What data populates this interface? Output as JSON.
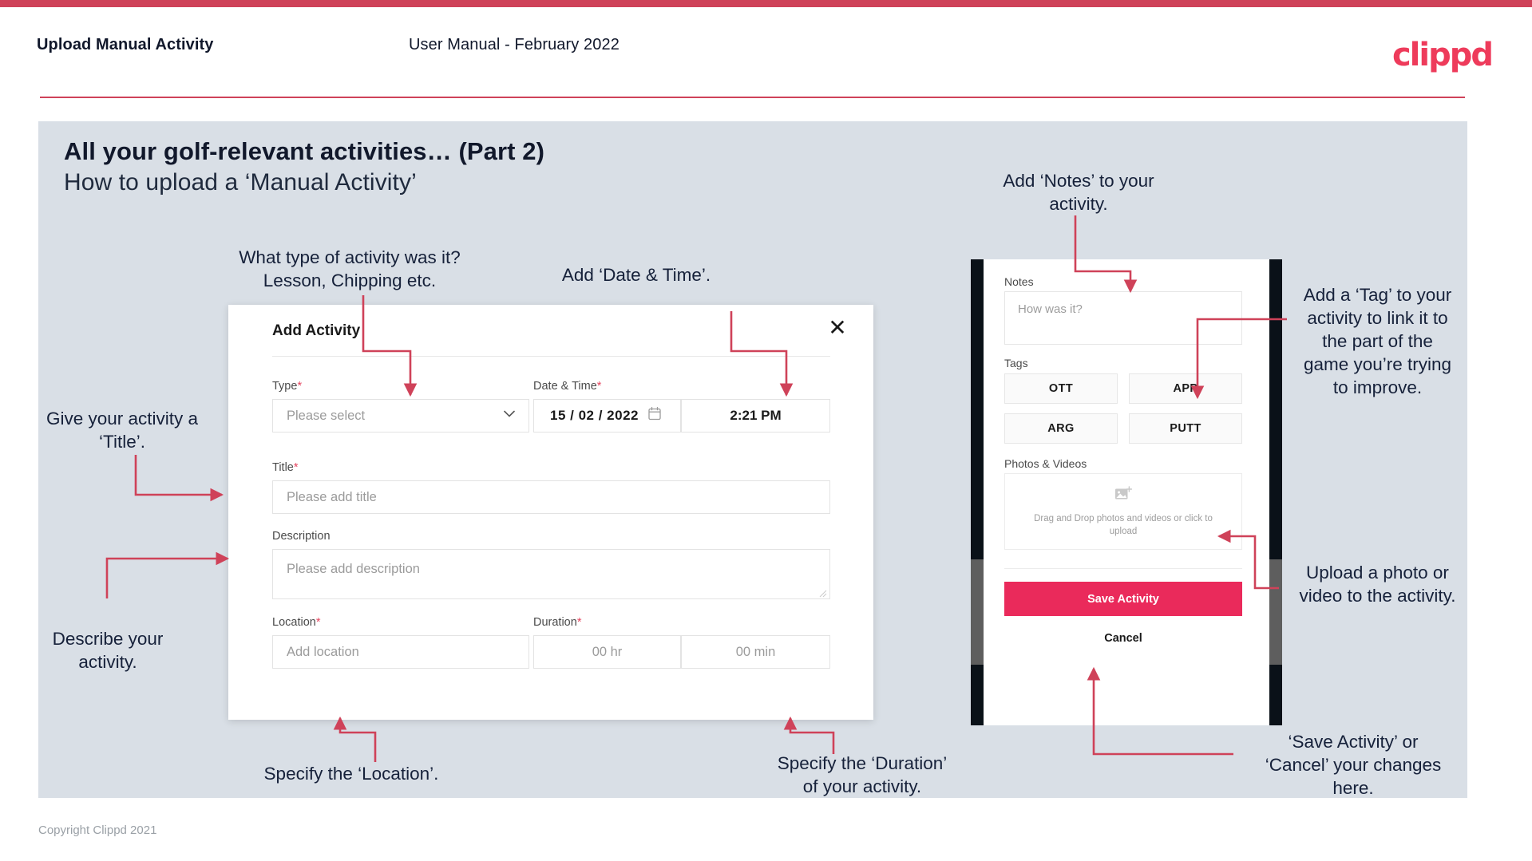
{
  "header": {
    "title": "Upload Manual Activity",
    "subtitle": "User Manual - February 2022",
    "logo": "clippd"
  },
  "slide": {
    "title": "All your golf-relevant activities… (Part 2)",
    "subtitle": "How to upload a ‘Manual Activity’"
  },
  "annotations": {
    "type": "What type of activity was it?\nLesson, Chipping etc.",
    "datetime": "Add ‘Date & Time’.",
    "title": "Give your activity a\n‘Title’.",
    "description": "Describe your\nactivity.",
    "location": "Specify the ‘Location’.",
    "duration": "Specify the ‘Duration’\nof your activity.",
    "notes": "Add ‘Notes’ to your\nactivity.",
    "tags": "Add a ‘Tag’ to your\nactivity to link it to\nthe part of the\ngame you’re trying\nto improve.",
    "upload": "Upload a photo or\nvideo to the activity.",
    "save": "‘Save Activity’ or\n‘Cancel’ your changes\nhere."
  },
  "modal": {
    "title": "Add Activity",
    "close_icon": "close-icon",
    "fields": {
      "type": {
        "label": "Type",
        "required": "*",
        "placeholder": "Please select",
        "icon": "chevron-down-icon"
      },
      "datetime": {
        "label": "Date & Time",
        "required": "*",
        "date_value": "15 /  02  / 2022",
        "time_value": "2:21 PM",
        "icon": "calendar-icon"
      },
      "title": {
        "label": "Title",
        "required": "*",
        "placeholder": "Please add title"
      },
      "description": {
        "label": "Description",
        "required": "",
        "placeholder": "Please add description"
      },
      "location": {
        "label": "Location",
        "required": "*",
        "placeholder": "Add location"
      },
      "duration": {
        "label": "Duration",
        "required": "*",
        "hours_placeholder": "00 hr",
        "minutes_placeholder": "00 min"
      }
    }
  },
  "phone": {
    "notes": {
      "label": "Notes",
      "placeholder": "How was it?"
    },
    "tags": {
      "label": "Tags",
      "items": [
        "OTT",
        "APP",
        "ARG",
        "PUTT"
      ]
    },
    "photos": {
      "label": "Photos & Videos",
      "icon": "add-image-icon",
      "drop_text": "Drag and Drop photos and videos or click to upload"
    },
    "save_label": "Save Activity",
    "cancel_label": "Cancel"
  },
  "footer": {
    "copyright": "Copyright Clippd 2021"
  },
  "colors": {
    "accent": "#cf4259",
    "brand": "#ee3b5b",
    "save": "#ea2a5b",
    "slide_bg": "#d9dfe6",
    "text_dark": "#11182b",
    "arrow": "#cf4259"
  }
}
